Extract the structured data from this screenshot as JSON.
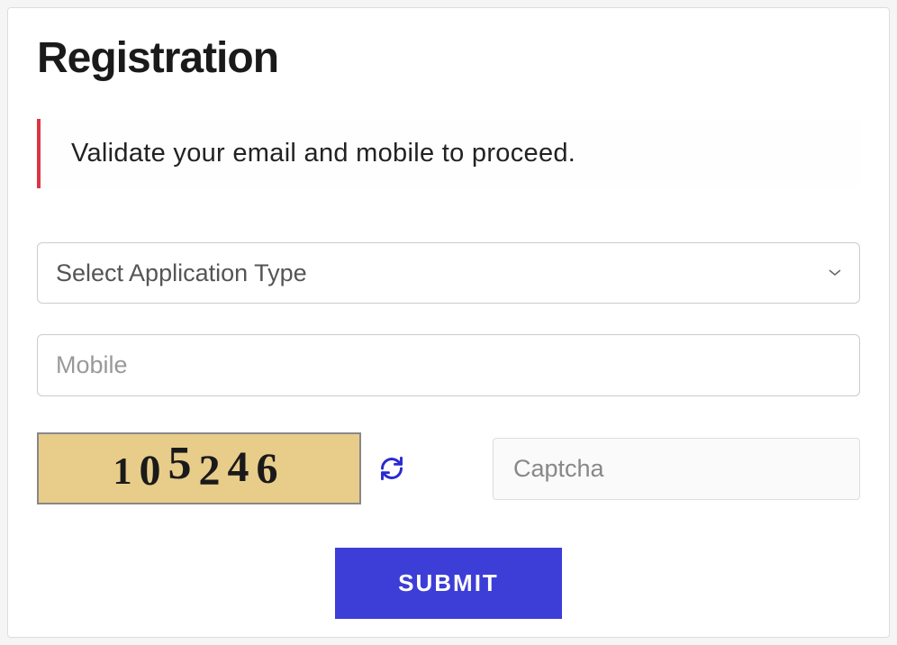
{
  "title": "Registration",
  "alert": {
    "message": "Validate your email and mobile to proceed."
  },
  "form": {
    "application_type": {
      "placeholder": "Select Application Type",
      "value": ""
    },
    "mobile": {
      "placeholder": "Mobile",
      "value": ""
    },
    "captcha": {
      "code": "105246",
      "placeholder": "Captcha",
      "value": ""
    },
    "submit_label": "SUBMIT"
  }
}
